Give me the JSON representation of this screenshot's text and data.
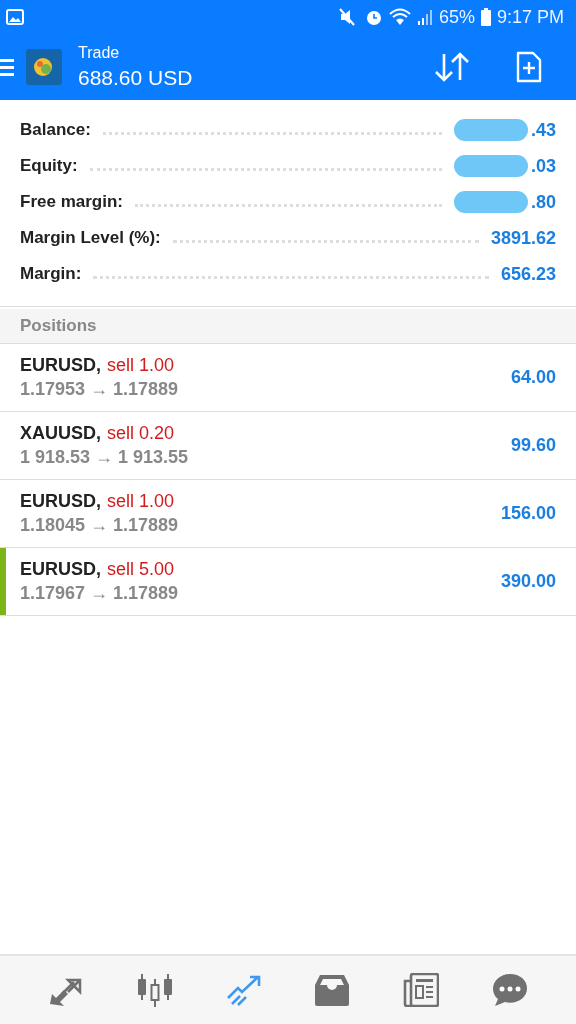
{
  "status_bar": {
    "battery": "65%",
    "time": "9:17 PM"
  },
  "header": {
    "title": "Trade",
    "balance": "688.60 USD"
  },
  "summary": [
    {
      "label": "Balance:",
      "value": ".43",
      "redacted": true
    },
    {
      "label": "Equity:",
      "value": ".03",
      "redacted": true
    },
    {
      "label": "Free margin:",
      "value": ".80",
      "redacted": true
    },
    {
      "label": "Margin Level (%):",
      "value": "3891.62",
      "redacted": false
    },
    {
      "label": "Margin:",
      "value": "656.23",
      "redacted": false
    }
  ],
  "section_title": "Positions",
  "positions": [
    {
      "symbol": "EURUSD,",
      "side": "sell 1.00",
      "prices": "1.17953 → 1.17889",
      "profit": "64.00",
      "selected": false
    },
    {
      "symbol": "XAUUSD,",
      "side": "sell 0.20",
      "prices": "1 918.53 → 1 913.55",
      "profit": "99.60",
      "selected": false
    },
    {
      "symbol": "EURUSD,",
      "side": "sell 1.00",
      "prices": "1.18045 → 1.17889",
      "profit": "156.00",
      "selected": false
    },
    {
      "symbol": "EURUSD,",
      "side": "sell 5.00",
      "prices": "1.17967 → 1.17889",
      "profit": "390.00",
      "selected": true
    }
  ],
  "nav": [
    {
      "kind": "quotes",
      "selected": false
    },
    {
      "kind": "chart",
      "selected": false
    },
    {
      "kind": "trade",
      "selected": true
    },
    {
      "kind": "mail",
      "selected": false
    },
    {
      "kind": "news",
      "selected": false
    },
    {
      "kind": "chat",
      "selected": false
    }
  ]
}
